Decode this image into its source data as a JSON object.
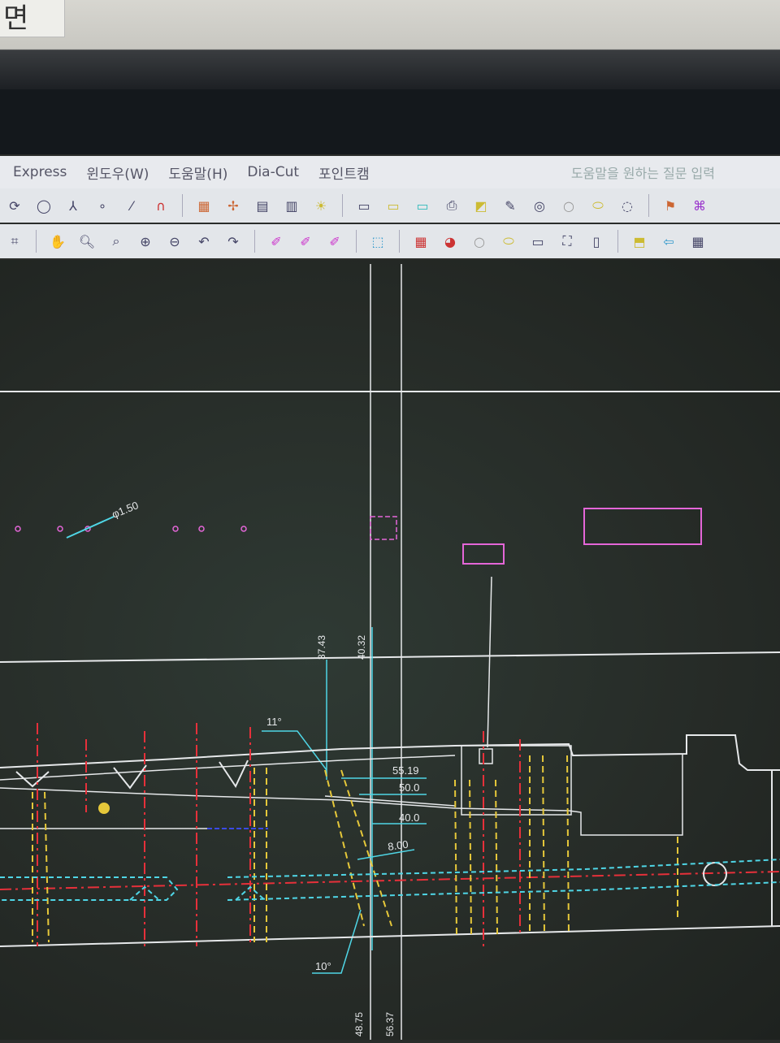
{
  "sticker": {
    "text": "면"
  },
  "menu": {
    "items": [
      "Express",
      "윈도우(W)",
      "도움말(H)",
      "Dia-Cut",
      "포인트캠"
    ],
    "help_placeholder": "도움말을 원하는 질문 입력"
  },
  "toolbar1": {
    "icons": [
      "arc-icon",
      "circle-icon",
      "branch-icon",
      "point-icon",
      "line-icon",
      "magnet-icon",
      "grid-icon",
      "spline-icon",
      "pl-spl-icon",
      "pl-pt-icon",
      "light-icon",
      "monitor-icon",
      "monitor-yellow-icon",
      "monitor-cyan-icon",
      "print-icon",
      "chart-icon",
      "edit-icon",
      "color-wheel-icon",
      "circle-icon",
      "lemon-icon",
      "hint-icon",
      "dimension-icon",
      "tree-icon"
    ]
  },
  "toolbar2": {
    "icons": [
      "frame-icon",
      "pan-icon",
      "zoom-in-icon",
      "zoom-window-icon",
      "zoom-plus-icon",
      "zoom-minus-icon",
      "undo-icon",
      "redo-icon",
      "pen-icon",
      "pen2-icon",
      "pen3-icon",
      "select-icon",
      "palette-icon",
      "pie-icon",
      "ring-icon",
      "lemon-icon",
      "monitor-icon",
      "crop-icon",
      "layers-icon",
      "export-icon",
      "arrow-left-icon",
      "grid-icon"
    ]
  },
  "drawing": {
    "labels": {
      "diameter": "φ1.50",
      "dim_37_43": "37.43",
      "dim_40_32": "40.32",
      "angle_11": "11°",
      "dim_55_19": "55.19",
      "dim_50_0": "50.0",
      "dim_40_0": "40.0",
      "dim_8_00": "8.00",
      "angle_10": "10°",
      "dim_48_75": "48.75",
      "dim_56_37": "56.37"
    },
    "colors": {
      "white": "#e6e8ea",
      "cyan": "#4fd6e6",
      "magenta": "#e466d8",
      "red": "#e6303a",
      "yellow": "#e6c83a",
      "blue": "#3a4ae6"
    }
  }
}
